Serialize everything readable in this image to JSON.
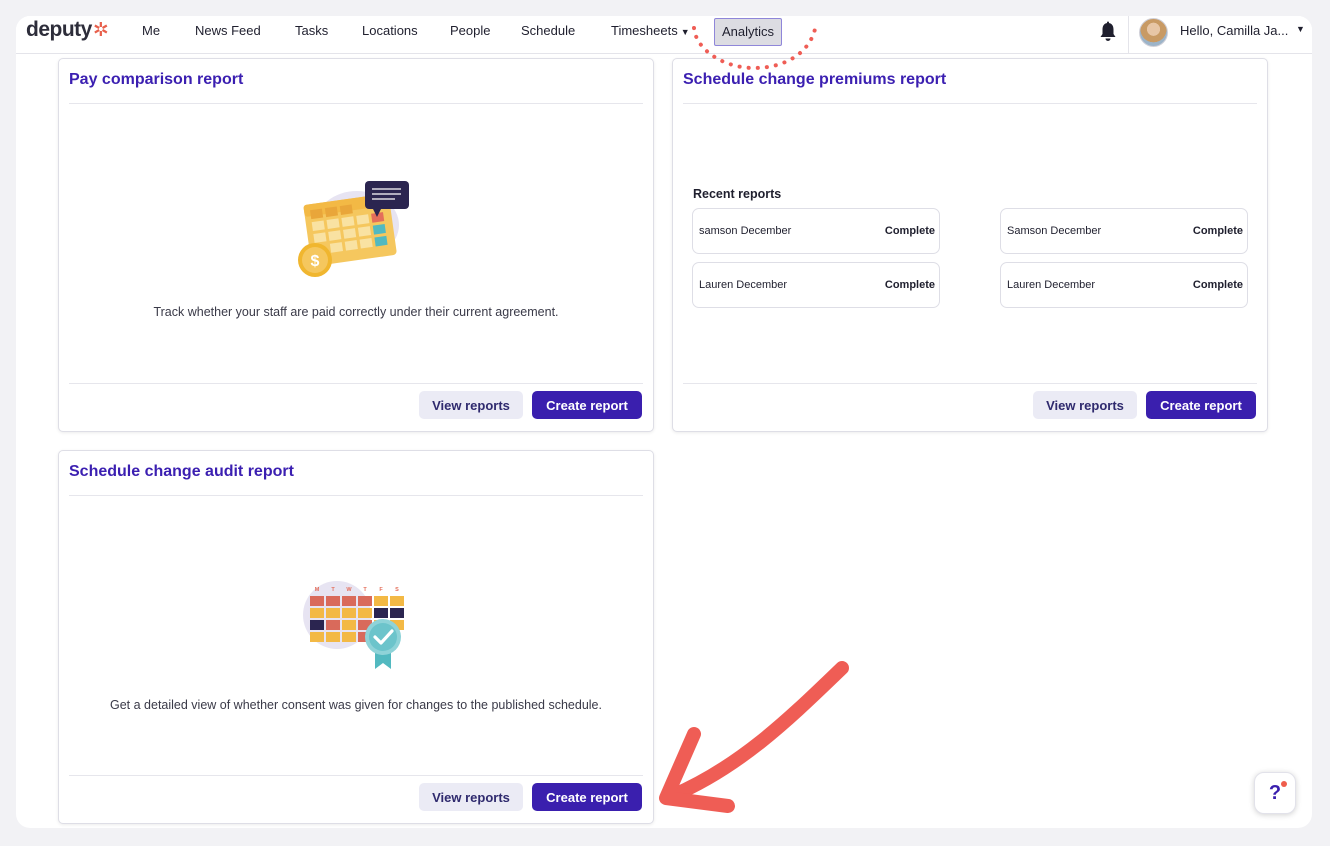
{
  "nav": {
    "logo_text": "deputy",
    "logo_mark": "✲",
    "items": [
      {
        "label": "Me"
      },
      {
        "label": "News Feed"
      },
      {
        "label": "Tasks"
      },
      {
        "label": "Locations"
      },
      {
        "label": "People"
      },
      {
        "label": "Schedule"
      },
      {
        "label": "Timesheets"
      }
    ],
    "active_item": "Analytics",
    "user_greeting": "Hello, Camilla Ja...",
    "notification_icon": "bell-icon"
  },
  "cards": {
    "pay_comparison": {
      "title": "Pay comparison report",
      "description": "Track whether your staff are paid correctly under their current agreement.",
      "view_label": "View reports",
      "create_label": "Create report"
    },
    "schedule_premiums": {
      "title": "Schedule change premiums report",
      "recent_title": "Recent reports",
      "recent": [
        {
          "name": "samson December",
          "status": "Complete"
        },
        {
          "name": "Samson December",
          "status": "Complete"
        },
        {
          "name": "Lauren December",
          "status": "Complete"
        },
        {
          "name": "Lauren December",
          "status": "Complete"
        }
      ],
      "view_label": "View reports",
      "create_label": "Create report"
    },
    "schedule_audit": {
      "title": "Schedule change audit report",
      "weekdays": [
        "M",
        "T",
        "W",
        "T",
        "F",
        "S"
      ],
      "description": "Get a detailed view of whether consent was given for changes to the published schedule.",
      "view_label": "View reports",
      "create_label": "Create report"
    }
  },
  "help": {
    "label": "?"
  },
  "colors": {
    "brand": "#3a1fae",
    "title": "#3b1fb1",
    "annotation": "#ef5d55"
  }
}
